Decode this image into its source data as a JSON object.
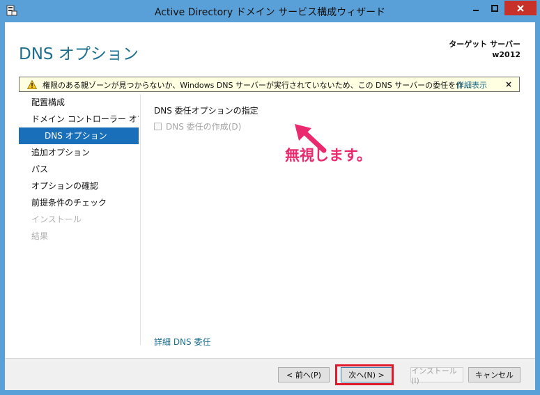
{
  "window": {
    "title": "Active Directory ドメイン サービス構成ウィザード",
    "controls": [
      "minimize-icon",
      "maximize-icon",
      "close-icon"
    ]
  },
  "header": {
    "page_title": "DNS オプション",
    "target_label": "ターゲット サーバー",
    "target_name": "w2012"
  },
  "warning": {
    "text": "権限のある親ゾーンが見つからないか、Windows DNS サーバーが実行されていないため、この DNS サーバーの委任を作…",
    "details_link": "詳細表示",
    "close": "×"
  },
  "nav": {
    "items": [
      {
        "label": "配置構成",
        "state": "normal"
      },
      {
        "label": "ドメイン コントローラー オプ…",
        "state": "normal"
      },
      {
        "label": "DNS オプション",
        "state": "selected"
      },
      {
        "label": "追加オプション",
        "state": "normal"
      },
      {
        "label": "パス",
        "state": "normal"
      },
      {
        "label": "オプションの確認",
        "state": "normal"
      },
      {
        "label": "前提条件のチェック",
        "state": "normal"
      },
      {
        "label": "インストール",
        "state": "disabled"
      },
      {
        "label": "結果",
        "state": "disabled"
      }
    ]
  },
  "content": {
    "section_title": "DNS 委任オプションの指定",
    "checkbox_label": "DNS 委任の作成(D)",
    "checkbox_checked": false,
    "link": "詳細 DNS 委任"
  },
  "buttons": {
    "prev": "< 前へ(P)",
    "next": "次へ(N) >",
    "install": "インストール(I)",
    "cancel": "キャンセル"
  },
  "annotation": {
    "callout": "無視します。"
  },
  "colors": {
    "titlebar": "#5aa0d8",
    "accent": "#1e6f8f",
    "nav_selected": "#1a6fba",
    "warning_bg": "#ffffe1",
    "callout": "#ea2a6e",
    "highlight": "#e0182a"
  }
}
